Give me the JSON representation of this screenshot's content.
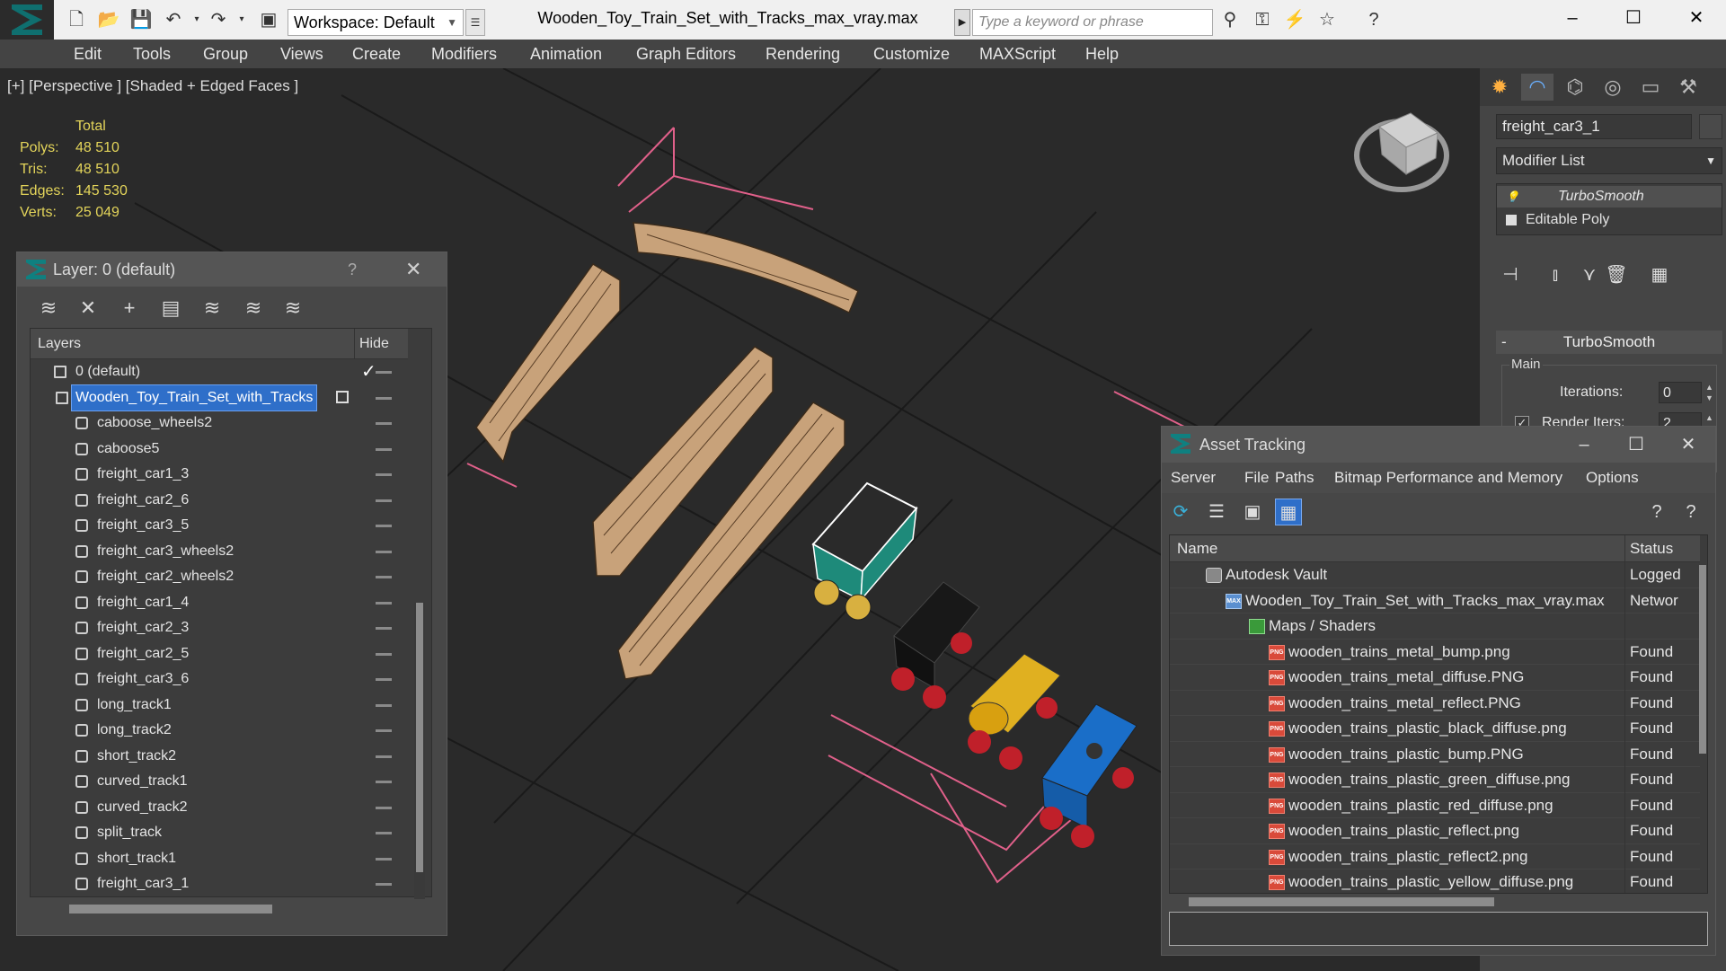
{
  "window": {
    "title": "Wooden_Toy_Train_Set_with_Tracks_max_vray.max",
    "workspace": "Workspace: Default",
    "search_placeholder": "Type a keyword or phrase"
  },
  "menu": [
    "Edit",
    "Tools",
    "Group",
    "Views",
    "Create",
    "Modifiers",
    "Animation",
    "Graph Editors",
    "Rendering",
    "Customize",
    "MAXScript",
    "Help"
  ],
  "viewport": {
    "label": "[+] [Perspective ] [Shaded + Edged Faces ]",
    "stats_header": "Total",
    "stats": [
      {
        "key": "Polys:",
        "value": "48 510"
      },
      {
        "key": "Tris:",
        "value": "48 510"
      },
      {
        "key": "Edges:",
        "value": "145 530"
      },
      {
        "key": "Verts:",
        "value": "25 049"
      }
    ]
  },
  "layer_panel": {
    "title": "Layer: 0 (default)",
    "help": "?",
    "col_layers": "Layers",
    "col_hide": "Hide",
    "layers": [
      {
        "name": "0 (default)",
        "type": "layer",
        "current": true
      },
      {
        "name": "Wooden_Toy_Train_Set_with_Tracks",
        "type": "layer",
        "selected": true
      },
      {
        "name": "caboose_wheels2",
        "type": "object"
      },
      {
        "name": "caboose5",
        "type": "object"
      },
      {
        "name": "freight_car1_3",
        "type": "object"
      },
      {
        "name": "freight_car2_6",
        "type": "object"
      },
      {
        "name": "freight_car3_5",
        "type": "object"
      },
      {
        "name": "freight_car3_wheels2",
        "type": "object"
      },
      {
        "name": "freight_car2_wheels2",
        "type": "object"
      },
      {
        "name": "freight_car1_4",
        "type": "object"
      },
      {
        "name": "freight_car2_3",
        "type": "object"
      },
      {
        "name": "freight_car2_5",
        "type": "object"
      },
      {
        "name": "freight_car3_6",
        "type": "object"
      },
      {
        "name": "long_track1",
        "type": "object"
      },
      {
        "name": "long_track2",
        "type": "object"
      },
      {
        "name": "short_track2",
        "type": "object"
      },
      {
        "name": "curved_track1",
        "type": "object"
      },
      {
        "name": "curved_track2",
        "type": "object"
      },
      {
        "name": "split_track",
        "type": "object"
      },
      {
        "name": "short_track1",
        "type": "object"
      },
      {
        "name": "freight_car3_1",
        "type": "object"
      }
    ]
  },
  "command_panel": {
    "object_name": "freight_car3_1",
    "modifier_list": "Modifier List",
    "stack": [
      "TurboSmooth",
      "Editable Poly"
    ],
    "rollout_title": "TurboSmooth",
    "group_main": "Main",
    "iterations_label": "Iterations:",
    "iterations_value": "0",
    "render_iters_label": "Render Iters:",
    "render_iters_value": "2",
    "render_iters_checked": true
  },
  "asset_tracking": {
    "title": "Asset Tracking",
    "menu": [
      "Server",
      "File",
      "Paths",
      "Bitmap Performance and Memory",
      "Options"
    ],
    "col_name": "Name",
    "col_status": "Status",
    "rows": [
      {
        "name": "Autodesk Vault",
        "status": "Logged",
        "icon": "vault",
        "indent": 1
      },
      {
        "name": "Wooden_Toy_Train_Set_with_Tracks_max_vray.max",
        "status": "Networ",
        "icon": "max",
        "indent": 2
      },
      {
        "name": "Maps / Shaders",
        "status": "",
        "icon": "map",
        "indent": 3
      },
      {
        "name": "wooden_trains_metal_bump.png",
        "status": "Found",
        "icon": "png",
        "indent": 4
      },
      {
        "name": "wooden_trains_metal_diffuse.PNG",
        "status": "Found",
        "icon": "png",
        "indent": 4
      },
      {
        "name": "wooden_trains_metal_reflect.PNG",
        "status": "Found",
        "icon": "png",
        "indent": 4
      },
      {
        "name": "wooden_trains_plastic_black_diffuse.png",
        "status": "Found",
        "icon": "png",
        "indent": 4
      },
      {
        "name": "wooden_trains_plastic_bump.PNG",
        "status": "Found",
        "icon": "png",
        "indent": 4
      },
      {
        "name": "wooden_trains_plastic_green_diffuse.png",
        "status": "Found",
        "icon": "png",
        "indent": 4
      },
      {
        "name": "wooden_trains_plastic_red_diffuse.png",
        "status": "Found",
        "icon": "png",
        "indent": 4
      },
      {
        "name": "wooden_trains_plastic_reflect.png",
        "status": "Found",
        "icon": "png",
        "indent": 4
      },
      {
        "name": "wooden_trains_plastic_reflect2.png",
        "status": "Found",
        "icon": "png",
        "indent": 4
      },
      {
        "name": "wooden_trains_plastic_yellow_diffuse.png",
        "status": "Found",
        "icon": "png",
        "indent": 4
      }
    ]
  },
  "colors": {
    "accent": "#2f6fc9",
    "stats_text": "#e3d45a",
    "track_wood": "#c8a27a",
    "selection_bracket": "#e0608a"
  }
}
